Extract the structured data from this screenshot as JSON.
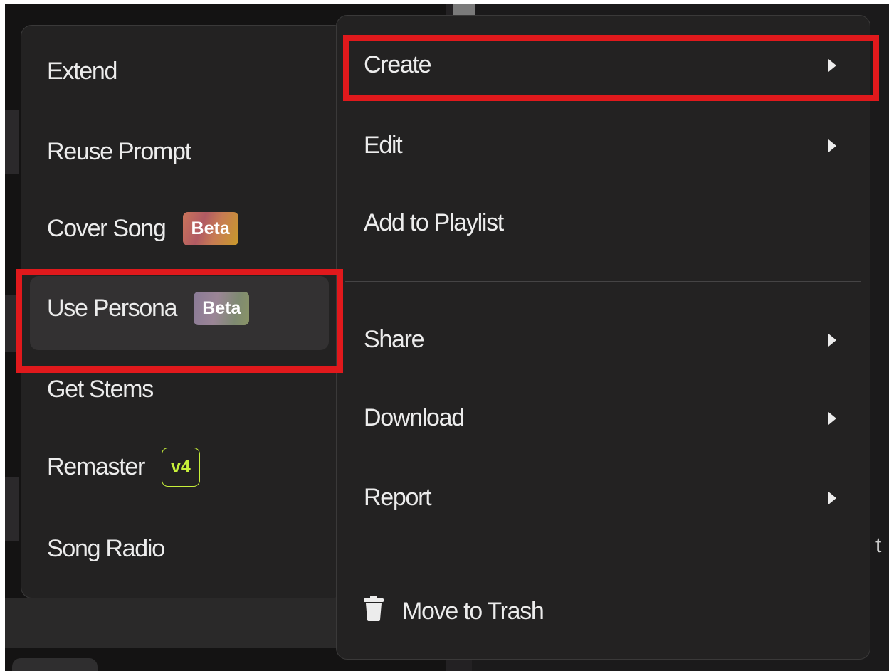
{
  "submenu": {
    "items": [
      {
        "label": "Extend"
      },
      {
        "label": "Reuse Prompt"
      },
      {
        "label": "Cover Song",
        "badge": "Beta"
      },
      {
        "label": "Use Persona",
        "badge": "Beta"
      },
      {
        "label": "Get Stems"
      },
      {
        "label": "Remaster",
        "badge": "v4"
      },
      {
        "label": "Song Radio"
      }
    ]
  },
  "main_menu": {
    "items": [
      {
        "label": "Create",
        "has_submenu": true
      },
      {
        "label": "Edit",
        "has_submenu": true
      },
      {
        "label": "Add to Playlist",
        "has_submenu": false
      },
      {
        "label": "Share",
        "has_submenu": true
      },
      {
        "label": "Download",
        "has_submenu": true
      },
      {
        "label": "Report",
        "has_submenu": true
      },
      {
        "label": "Move to Trash",
        "icon": "trash-icon"
      }
    ]
  },
  "background": {
    "partial_text": "j t"
  },
  "colors": {
    "menu_bg": "#232222",
    "highlight": "#e0191c",
    "v4_accent": "#c7f03a"
  }
}
